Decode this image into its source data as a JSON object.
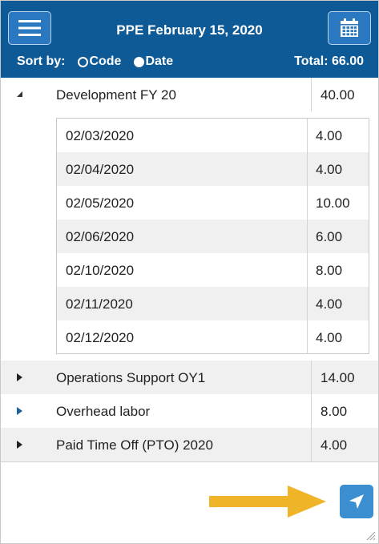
{
  "header": {
    "title": "PPE February 15, 2020",
    "menu_icon": "hamburger-icon",
    "calendar_icon": "calendar-icon",
    "sort_label": "Sort by:",
    "sort_options": [
      {
        "label": "Code",
        "selected": true
      },
      {
        "label": "Date",
        "selected": false
      }
    ],
    "total": "Total: 66.00"
  },
  "groups": [
    {
      "label": "Development FY 20",
      "value": "40.00",
      "expanded": true,
      "entries": [
        {
          "date": "02/03/2020",
          "value": "4.00"
        },
        {
          "date": "02/04/2020",
          "value": "4.00"
        },
        {
          "date": "02/05/2020",
          "value": "10.00"
        },
        {
          "date": "02/06/2020",
          "value": "6.00"
        },
        {
          "date": "02/10/2020",
          "value": "8.00"
        },
        {
          "date": "02/11/2020",
          "value": "4.00"
        },
        {
          "date": "02/12/2020",
          "value": "4.00"
        }
      ]
    },
    {
      "label": "Operations Support OY1",
      "value": "14.00",
      "expanded": false
    },
    {
      "label": "Overhead labor",
      "value": "8.00",
      "expanded": false
    },
    {
      "label": "Paid Time Off (PTO) 2020",
      "value": "4.00",
      "expanded": false
    }
  ],
  "footer": {
    "send_icon": "send-icon",
    "annotation_arrow_color": "#f0b429"
  },
  "colors": {
    "header_bg": "#0e5a96",
    "button_bg": "#2a78bf",
    "send_bg": "#3b8fd0"
  }
}
